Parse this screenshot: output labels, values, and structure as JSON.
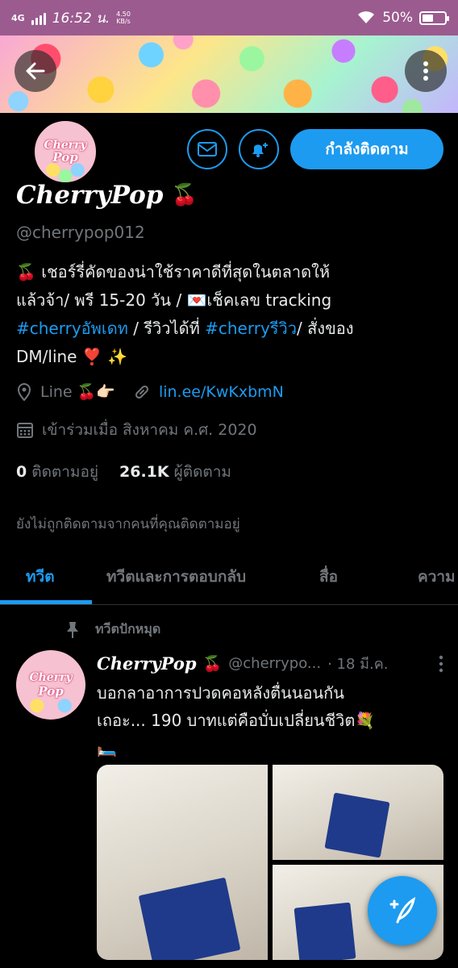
{
  "status_bar": {
    "network": "4G",
    "time": "16:52 น.",
    "speed_value": "4.50",
    "speed_unit": "KB/s",
    "battery_text": "50%",
    "battery_level": 0.5
  },
  "header": {
    "back_icon": "arrow-left-icon",
    "more_icon": "more-vertical-icon"
  },
  "profile": {
    "avatar_text_1": "Cherry",
    "avatar_text_2": "Pop",
    "name": "CherryPop",
    "name_emoji": "🍒",
    "handle": "@cherrypop012",
    "follow_label": "กำลังติดตาม",
    "bio_line1": "🍒 เชอร์รี่คัดของน่าใช้ราคาดีที่สุดในตลาดให้",
    "bio_line2": "แล้วจ้า/ พรี 15-20 วัน  / 💌เช็คเลข tracking",
    "bio_hashtag1": "#cherryอัพเดท",
    "bio_mid": " / รีวิวได้ที่ ",
    "bio_hashtag2": "#cherryรีวิว",
    "bio_tail": "/ สั่งของ",
    "bio_line4": "DM/line ❣️ ✨",
    "location": "Line 🍒👉🏻",
    "website": "lin.ee/KwKxbmN",
    "joined": "เข้าร่วมเมื่อ สิงหาคม ค.ศ. 2020",
    "following_count": "0",
    "following_label": "ติดตามอยู่",
    "followers_count": "26.1K",
    "followers_label": "ผู้ติดตาม",
    "not_followed": "ยังไม่ถูกติดตามจากคนที่คุณติดตามอยู่"
  },
  "tabs": [
    {
      "label": "ทวีต"
    },
    {
      "label": "ทวีตและการตอบกลับ"
    },
    {
      "label": "สื่อ"
    },
    {
      "label": "ความ"
    }
  ],
  "tweet": {
    "pinned_label": "ทวีตปักหมุด",
    "name": "CherryPop",
    "name_emoji": "🍒",
    "handle": "@cherrypo...",
    "date": "· 18 มี.ค.",
    "text_line1": "บอกลาอาการปวดคอหลังตื่นนอนกัน",
    "text_line2": "เถอะ... 190 บาทแต่คือบั่บเปลี่ยนชีวิต💐",
    "text_line3": "🛏️"
  },
  "colors": {
    "accent": "#1d9bf0",
    "status_bar": "#9b5b8f",
    "background": "#000000",
    "secondary_text": "#71767b"
  }
}
